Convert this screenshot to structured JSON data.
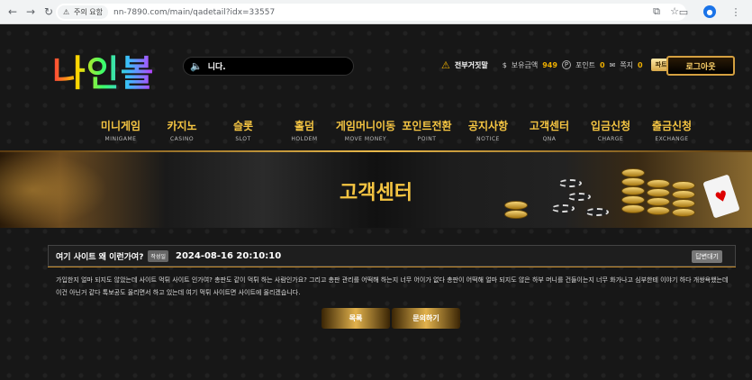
{
  "browser": {
    "security_warning": "주의 요함",
    "url": "nn-7890.com/main/qadetail?idx=33557",
    "icons": [
      "back-icon",
      "forward-icon",
      "reload-icon",
      "star-icon",
      "extension-icon",
      "split-icon",
      "profile-icon",
      "menu-icon"
    ]
  },
  "site": {
    "logo_text": "나인볼",
    "ticker_text": "니다.",
    "user": {
      "nickname": "전부거짓말",
      "balance_label": "보유금액",
      "balance_value": "949",
      "points_label": "포인트",
      "points_value": "0",
      "messages_label": "쪽지",
      "messages_value": "0",
      "partner_label": "파트너",
      "logout_label": "로그아웃"
    },
    "nav": [
      {
        "label": "미니게임",
        "sub": "MINIGAME"
      },
      {
        "label": "카지노",
        "sub": "CASINO"
      },
      {
        "label": "슬롯",
        "sub": "SLOT"
      },
      {
        "label": "홀덤",
        "sub": "HOLDEM"
      },
      {
        "label": "게임머니이동",
        "sub": "MOVE MONEY"
      },
      {
        "label": "포인트전환",
        "sub": "POINT"
      },
      {
        "label": "공지사항",
        "sub": "NOTICE"
      },
      {
        "label": "고객센터",
        "sub": "QNA"
      },
      {
        "label": "입금신청",
        "sub": "CHARGE"
      },
      {
        "label": "출금신청",
        "sub": "EXCHANGE"
      }
    ],
    "hero_title": "고객센터",
    "post": {
      "title": "여기 사이트 왜 이런가여?",
      "author_badge": "작성일",
      "date": "2024-08-16 20:10:10",
      "status": "답변대기",
      "body": "가입한지 얼마 되지도 않았는데 사이트 먹튀 사이트 인가여? 총판도 같이 먹튀 하는 사람인가요? 그리고 총판 관리를 어떡해 하는지 너무 어이가 없다 총판이 어떡해 얼마 되지도 않은 하부 머니를 건들이는지 너무 화가나고 심부한테 이야기 하다 개쌍욕했는데 이건 아닌거 같다 톡보공도 올리면서 하고 있는데 여기 먹튀 사이트면 사이트에 올리겠습니다."
    },
    "buttons": {
      "list_label": "목록",
      "inquiry_label": "문의하기"
    }
  }
}
